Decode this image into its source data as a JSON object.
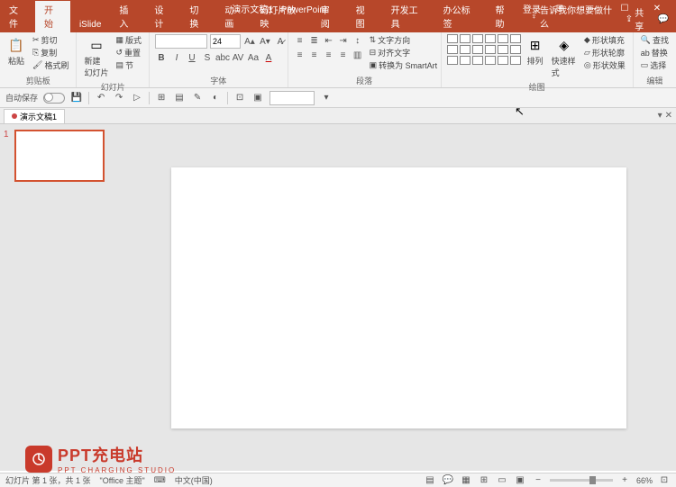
{
  "titlebar": {
    "title": "演示文稿1 - PowerPoint",
    "login": "登录"
  },
  "tabs": [
    "文件",
    "开始",
    "iSlide",
    "插入",
    "设计",
    "切换",
    "动画",
    "幻灯片放映",
    "审阅",
    "视图",
    "开发工具",
    "办公标签",
    "帮助"
  ],
  "active_tab": 1,
  "tell_me": "告诉我你想要做什么",
  "share": "共享",
  "ribbon": {
    "clipboard": {
      "label": "剪贴板",
      "paste": "粘贴",
      "cut": "剪切",
      "copy": "复制",
      "format_painter": "格式刷"
    },
    "slides": {
      "label": "幻灯片",
      "new_slide": "新建\n幻灯片",
      "layout": "版式",
      "reset": "重置",
      "section": "节"
    },
    "font": {
      "label": "字体",
      "size": "24"
    },
    "paragraph": {
      "label": "段落",
      "text_direction": "文字方向",
      "align_text": "对齐文字",
      "convert_smartart": "转换为 SmartArt"
    },
    "drawing": {
      "label": "绘图",
      "arrange": "排列",
      "quick_styles": "快速样式",
      "shape_fill": "形状填充",
      "shape_outline": "形状轮廓",
      "shape_effects": "形状效果"
    },
    "editing": {
      "label": "编辑",
      "find": "查找",
      "replace": "替换",
      "select": "选择"
    }
  },
  "qat": {
    "autosave": "自动保存"
  },
  "doc_tab": "演示文稿1",
  "thumb_num": "1",
  "watermark": {
    "main": "PPT充电站",
    "sub": "PPT CHARGING STUDIO"
  },
  "status": {
    "slide_info": "幻灯片 第 1 张，共 1 张",
    "theme": "\"Office 主题\"",
    "lang": "中文(中国)",
    "zoom": "66%"
  }
}
